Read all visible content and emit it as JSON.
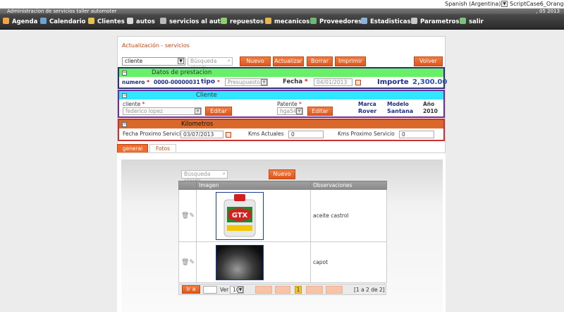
{
  "top": {
    "language": "Spanish (Argentina)",
    "theme": "ScriptCase6_Orange"
  },
  "titlebar": {
    "title": "Administracion de servicios taller automoter",
    "right": ", 05 2013"
  },
  "menu": [
    {
      "label": "Agenda",
      "icon": "agenda-icon",
      "color": "#f4a340"
    },
    {
      "label": "Calendario",
      "icon": "calendar-icon",
      "color": "#6aa3d8"
    },
    {
      "label": "Clientes",
      "icon": "users-icon",
      "color": "#e6c34d"
    },
    {
      "label": "autos",
      "icon": "car-icon",
      "color": "#d9d9d9"
    },
    {
      "label": "servicios al auto",
      "icon": "service-icon",
      "color": "#b9b9b9"
    },
    {
      "label": "repuestos",
      "icon": "parts-icon",
      "color": "#8fcf6b"
    },
    {
      "label": "mecanicos",
      "icon": "mechanic-icon",
      "color": "#e8b54a"
    },
    {
      "label": "Proveedores",
      "icon": "suppliers-icon",
      "color": "#6fb86f"
    },
    {
      "label": "Estadisticas",
      "icon": "stats-icon",
      "color": "#8bb2e0"
    },
    {
      "label": "Parametros",
      "icon": "settings-icon",
      "color": "#c9c9c9"
    },
    {
      "label": "salir",
      "icon": "exit-icon",
      "color": "#7ec07e"
    }
  ],
  "panel": {
    "title": "Actualización - servicios",
    "filter_select": "cliente",
    "search_placeholder": "Búsqueda rápida",
    "buttons": {
      "nuevo": "Nuevo",
      "actualizar": "Actualizar",
      "borrar": "Borrar",
      "imprimir": "Imprimir",
      "volver": "Volver"
    }
  },
  "datos": {
    "header": "Datos de prestacion",
    "numero_label": "numero",
    "numero": "0000-00000031",
    "tipo_label": "tipo",
    "tipo": "Presupuesto",
    "fecha_label": "Fecha",
    "fecha": "04/01/2013",
    "importe_label": "Importe",
    "importe": "2,300.00"
  },
  "cliente": {
    "header": "Cliente",
    "cliente_label": "cliente",
    "cliente_value": "federico lopez",
    "editar": "Editar",
    "patente_label": "Patente",
    "patente_value": "hga540",
    "marca_label": "Marca",
    "marca": "Rover",
    "modelo_label": "Modelo",
    "modelo": "Santana",
    "anio_label": "Año",
    "anio": "2010"
  },
  "km": {
    "header": "Kilometros",
    "fecha_prox_label": "Fecha Proximo Servicio",
    "fecha_prox": "03/07/2013",
    "kms_actuales_label": "Kms Actuales",
    "kms_actuales": "0",
    "kms_prox_label": "Kms Proximo Servicio",
    "kms_prox": "0"
  },
  "tabs": {
    "general": "general",
    "fotos": "Fotos"
  },
  "grid": {
    "search_placeholder": "Búsqueda rápida",
    "nuevo": "Nuevo",
    "col_imagen": "Imagen",
    "col_obs": "Observaciones",
    "rows": [
      {
        "obs": "aceite castrol",
        "image": "oil-bottle"
      },
      {
        "obs": "capot",
        "image": "car-hood"
      }
    ],
    "pager": {
      "ir_a": "Ir a",
      "ver": "Ver",
      "per_page": "10",
      "current_page": "1",
      "summary": "[1 a 2 de 2]"
    },
    "bottle_label": "GTX"
  }
}
